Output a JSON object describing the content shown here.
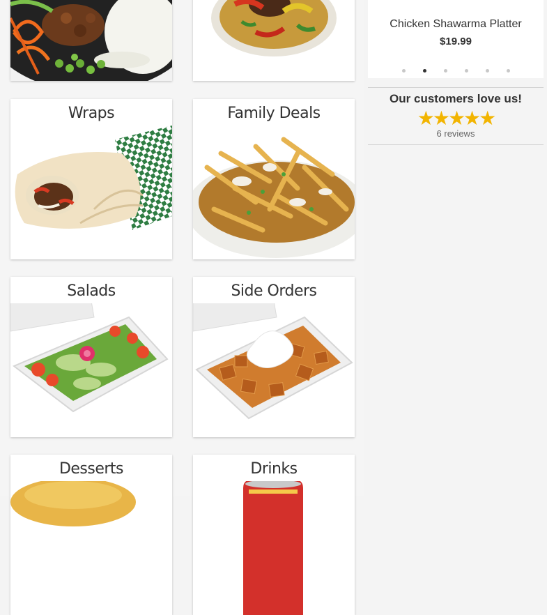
{
  "categories": [
    {
      "title": "",
      "icon": "rice-bowl-image"
    },
    {
      "title": "",
      "icon": "rice-plate-image"
    },
    {
      "title": "Wraps",
      "icon": "wrap-image"
    },
    {
      "title": "Family Deals",
      "icon": "fries-poutine-image"
    },
    {
      "title": "Salads",
      "icon": "salad-container-image"
    },
    {
      "title": "Side Orders",
      "icon": "potatoes-container-image"
    },
    {
      "title": "Desserts",
      "icon": "dessert-image"
    },
    {
      "title": "Drinks",
      "icon": "soda-can-image"
    }
  ],
  "featured": {
    "name": "Chicken Shawarma Platter",
    "price": "$19.99",
    "slides": 6,
    "active_slide": 2
  },
  "reviews": {
    "title": "Our customers love us!",
    "rating": 5,
    "stars": "★★★★★",
    "count_label": "6 reviews"
  },
  "colors": {
    "star": "#f2b400",
    "active_dot": "#333333",
    "dot": "#c8c8c8"
  }
}
